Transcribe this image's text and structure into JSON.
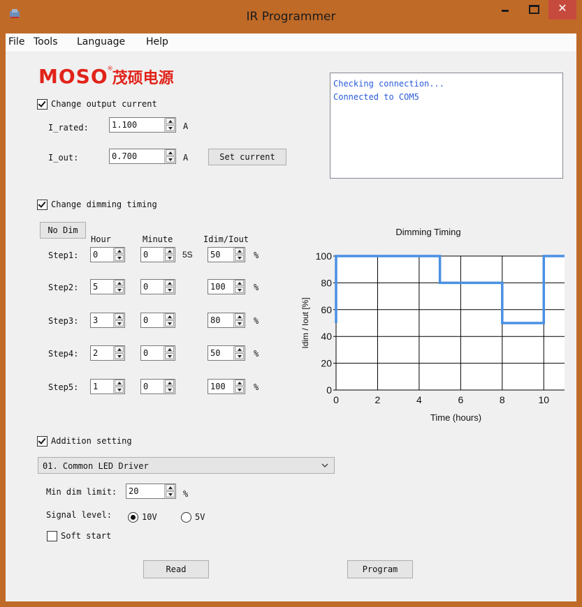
{
  "window": {
    "title": "IR Programmer",
    "close_glyph": "✕"
  },
  "menu": {
    "file": "File",
    "tools": "Tools",
    "language": "Language",
    "help": "Help"
  },
  "logo": {
    "brand": "MOSO",
    "registered": "®",
    "chinese": "茂硕电源",
    "color": "#e1231a"
  },
  "current_section": {
    "checkbox_label": "Change output current",
    "checked": true,
    "i_rated_label": "I_rated:",
    "i_rated_value": "1.100",
    "i_rated_unit": "A",
    "i_out_label": "I_out:",
    "i_out_value": "0.700",
    "i_out_unit": "A",
    "set_current_button": "Set current"
  },
  "log": {
    "lines": [
      "Checking connection...",
      "Connected to COM5"
    ],
    "color": "#2a5bd7"
  },
  "dimming_section": {
    "checkbox_label": "Change dimming timing",
    "checked": true,
    "no_dim_button": "No Dim",
    "col_hour": "Hour",
    "col_minute": "Minute",
    "col_idim": "Idim/Iout",
    "step_note": "5S",
    "percent_unit": "%",
    "steps": [
      {
        "label": "Step1:",
        "hour": "0",
        "minute": "0",
        "idim": "50"
      },
      {
        "label": "Step2:",
        "hour": "5",
        "minute": "0",
        "idim": "100"
      },
      {
        "label": "Step3:",
        "hour": "3",
        "minute": "0",
        "idim": "80"
      },
      {
        "label": "Step4:",
        "hour": "2",
        "minute": "0",
        "idim": "50"
      },
      {
        "label": "Step5:",
        "hour": "1",
        "minute": "0",
        "idim": "100"
      }
    ]
  },
  "addition_section": {
    "checkbox_label": "Addition setting",
    "checked": true,
    "driver_selected": "01. Common LED Driver",
    "min_dim_label": "Min dim limit:",
    "min_dim_value": "20",
    "min_dim_unit": "%",
    "signal_label": "Signal level:",
    "signal_options": [
      "10V",
      "5V"
    ],
    "signal_selected": "10V",
    "soft_start_label": "Soft start",
    "soft_start_checked": false,
    "read_button": "Read",
    "program_button": "Program"
  },
  "chart_data": {
    "type": "line",
    "title": "Dimming Timing",
    "xlabel": "Time (hours)",
    "ylabel": "Idim / Iout [%]",
    "xlim": [
      0,
      11
    ],
    "ylim": [
      0,
      100
    ],
    "xticks": [
      0,
      2,
      4,
      6,
      8,
      10
    ],
    "yticks": [
      0,
      20,
      40,
      60,
      80,
      100
    ],
    "grid": true,
    "line_color": "#4a90e2",
    "series": [
      {
        "x": [
          0,
          0,
          5,
          5,
          8,
          8,
          10,
          10,
          11
        ],
        "y": [
          50,
          100,
          100,
          80,
          80,
          50,
          50,
          100,
          100
        ]
      }
    ]
  }
}
